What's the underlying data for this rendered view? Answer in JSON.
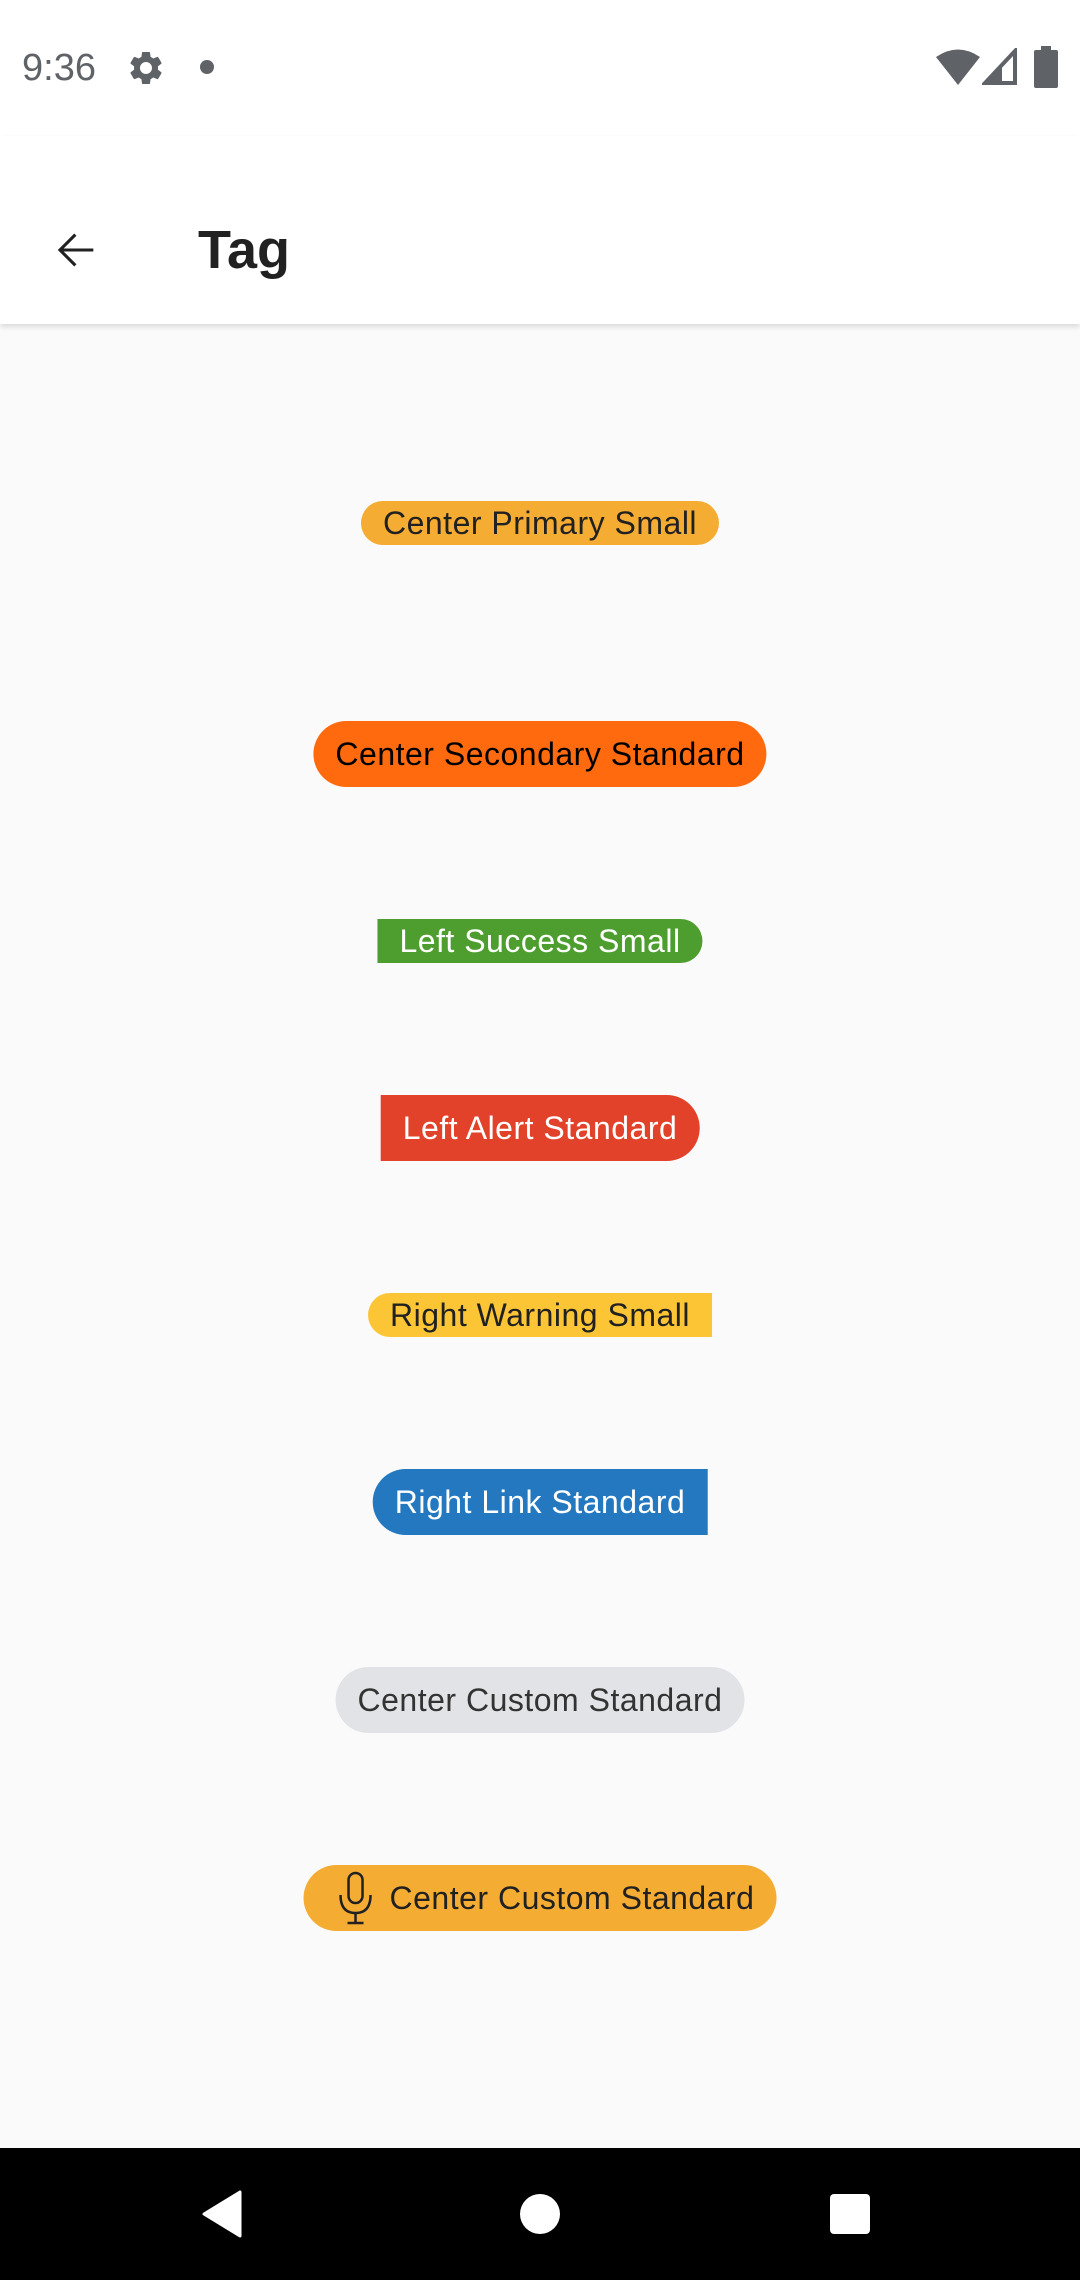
{
  "status_bar": {
    "time": "9:36",
    "icons": [
      "gear-icon",
      "notification-dot-icon",
      "wifi-icon",
      "signal-icon",
      "battery-icon"
    ]
  },
  "app_bar": {
    "title": "Tag",
    "back_icon": "arrow-left-icon"
  },
  "tags": [
    {
      "label": "Center Primary Small",
      "alignment": "center",
      "variant": "primary",
      "size": "small",
      "background": "#F5AC32",
      "text_color": "#212121",
      "shape": "pill"
    },
    {
      "label": "Center Secondary Standard",
      "alignment": "center",
      "variant": "secondary",
      "size": "standard",
      "background": "#FF6A0E",
      "text_color": "#000000",
      "shape": "pill"
    },
    {
      "label": "Left Success Small",
      "alignment": "left",
      "variant": "success",
      "size": "small",
      "background": "#4D9E2F",
      "text_color": "#FFFFFF",
      "shape": "flat-left"
    },
    {
      "label": "Left Alert Standard",
      "alignment": "left",
      "variant": "alert",
      "size": "standard",
      "background": "#E2422A",
      "text_color": "#FFFFFF",
      "shape": "flat-left"
    },
    {
      "label": "Right Warning Small",
      "alignment": "right",
      "variant": "warning",
      "size": "small",
      "background": "#FBC535",
      "text_color": "#212121",
      "shape": "flat-right"
    },
    {
      "label": "Right Link Standard",
      "alignment": "right",
      "variant": "link",
      "size": "standard",
      "background": "#2478C0",
      "text_color": "#FFFFFF",
      "shape": "flat-right"
    },
    {
      "label": "Center Custom Standard",
      "alignment": "center",
      "variant": "custom",
      "size": "standard",
      "background": "#E1E3E6",
      "text_color": "#333333",
      "shape": "pill"
    },
    {
      "label": "Center Custom Standard",
      "alignment": "center",
      "variant": "custom-icon",
      "size": "standard",
      "background": "#F5AC32",
      "text_color": "#212121",
      "shape": "pill",
      "icon": "microphone-icon"
    }
  ],
  "nav_bar": {
    "icons": [
      "back-triangle-icon",
      "home-circle-icon",
      "recents-square-icon"
    ]
  }
}
